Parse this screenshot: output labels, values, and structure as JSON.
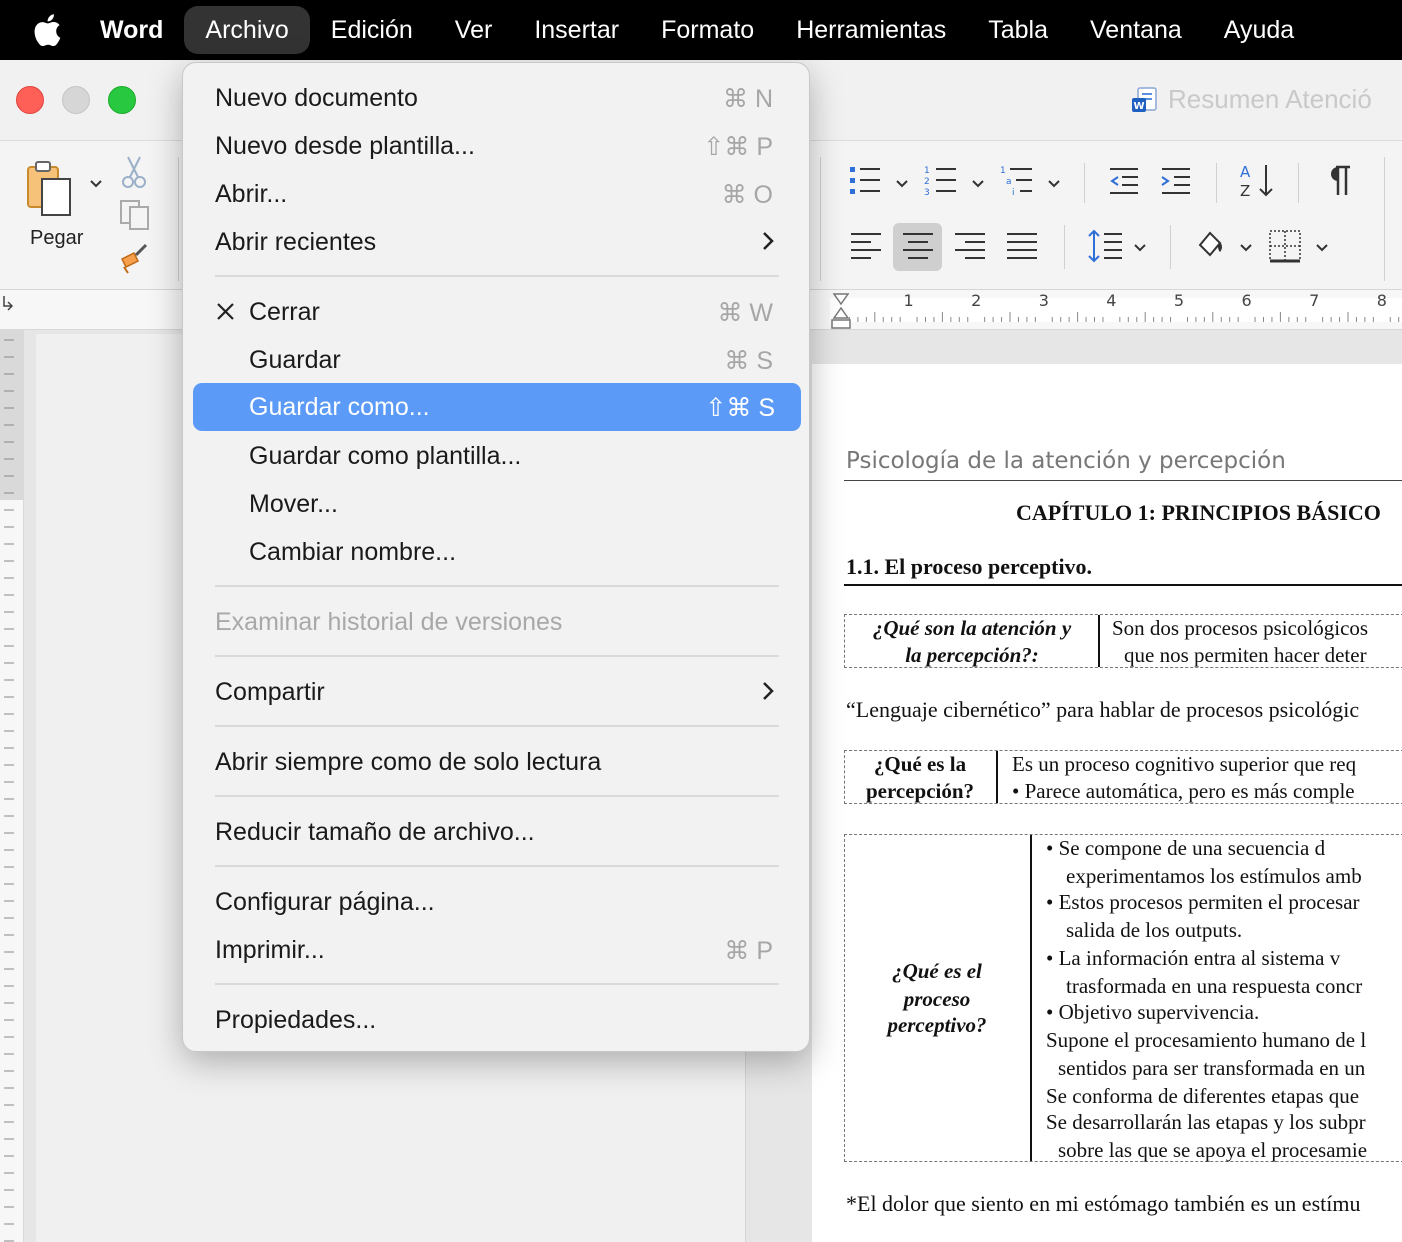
{
  "menubar": {
    "app_name": "Word",
    "items": [
      "Archivo",
      "Edición",
      "Ver",
      "Insertar",
      "Formato",
      "Herramientas",
      "Tabla",
      "Ventana",
      "Ayuda"
    ]
  },
  "window": {
    "title": "Resumen Atenció"
  },
  "ribbon": {
    "paste_label": "Pegar"
  },
  "ruler": {
    "numbers": [
      "1",
      "2",
      "3",
      "4",
      "5",
      "6",
      "7",
      "8"
    ]
  },
  "file_menu": {
    "items": [
      {
        "label": "Nuevo documento",
        "shortcut": "⌘ N"
      },
      {
        "label": "Nuevo desde plantilla...",
        "shortcut": "⇧⌘ P"
      },
      {
        "label": "Abrir...",
        "shortcut": "⌘ O"
      },
      {
        "label": "Abrir recientes"
      },
      {
        "label": "Cerrar",
        "shortcut": "⌘ W"
      },
      {
        "label": "Guardar",
        "shortcut": "⌘ S"
      },
      {
        "label": "Guardar como...",
        "shortcut": "⇧⌘ S"
      },
      {
        "label": "Guardar como plantilla..."
      },
      {
        "label": "Mover..."
      },
      {
        "label": "Cambiar nombre..."
      },
      {
        "label": "Examinar historial de versiones"
      },
      {
        "label": "Compartir"
      },
      {
        "label": "Abrir siempre como de solo lectura"
      },
      {
        "label": "Reducir tamaño de archivo..."
      },
      {
        "label": "Configurar página..."
      },
      {
        "label": "Imprimir...",
        "shortcut": "⌘ P"
      },
      {
        "label": "Propiedades..."
      }
    ]
  },
  "document": {
    "running_header": "Psicología de la atención y percepción",
    "chapter_title": "CAPÍTULO 1: PRINCIPIOS BÁSICO",
    "section_title": "1.1. El proceso perceptivo.",
    "table1": {
      "q_lines": [
        "¿Qué son la atención y",
        "la percepción?:"
      ],
      "a_lines": [
        "Son dos procesos psicológicos",
        "que nos permiten hacer deter"
      ]
    },
    "para1": "“Lenguaje cibernético” para hablar de procesos psicológic",
    "table2": {
      "q_lines": [
        "¿Qué es la",
        "percepción?"
      ],
      "a_lines": [
        "Es un proceso cognitivo superior que req",
        "• Parece automática, pero es más comple"
      ]
    },
    "table3": {
      "q_lines": [
        "¿Qué es el",
        "proceso",
        "perceptivo?"
      ],
      "a_lines": [
        "•  Se  compone  de  una  secuencia  d",
        "experimentamos los estímulos amb",
        "• Estos procesos permiten el procesar",
        "salida de los outputs.",
        "•  La  información  entra  al  sistema  v",
        "trasformada en una respuesta concr",
        "• Objetivo supervivencia.",
        "Supone el procesamiento humano de l",
        "sentidos para ser transformada en un",
        "Se conforma de diferentes etapas que",
        "Se desarrollarán las etapas y los subpr",
        "sobre las que se apoya el procesamie"
      ]
    },
    "footnote": "*El dolor que siento en mi estómago también es un estímu"
  }
}
